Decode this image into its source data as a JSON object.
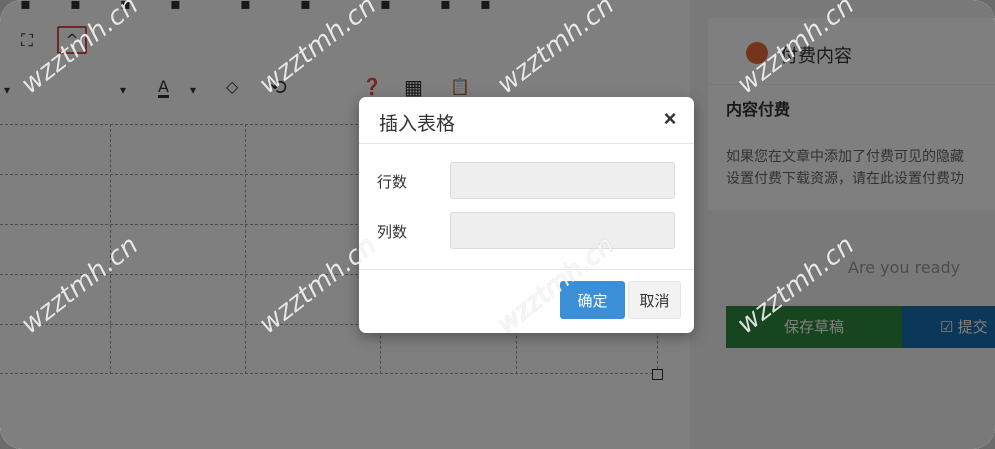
{
  "editor": {
    "collapse_glyph": "^",
    "fullscreen_glyph": "⛶",
    "toolbar2": {
      "font_color_label": "A",
      "undo_glyph": "⟲",
      "help_glyph": "❓",
      "table_glyph": "▦",
      "paste_glyph": "📋"
    }
  },
  "right_panel": {
    "paid_title": "付费内容",
    "paid_subtitle": "内容付费",
    "paid_desc_line1": "如果您在文章中添加了付费可见的隐藏",
    "paid_desc_line2": "设置付费下载资源，请在此设置付费功",
    "ready_text": "Are you ready",
    "save_draft_label": "保存草稿",
    "submit_label": "☑ 提交"
  },
  "modal": {
    "title": "插入表格",
    "close_label": "×",
    "rows_label": "行数",
    "rows_value": "",
    "cols_label": "列数",
    "cols_value": "",
    "confirm_label": "确定",
    "cancel_label": "取消"
  },
  "watermark_text": "wzztmh.cn"
}
